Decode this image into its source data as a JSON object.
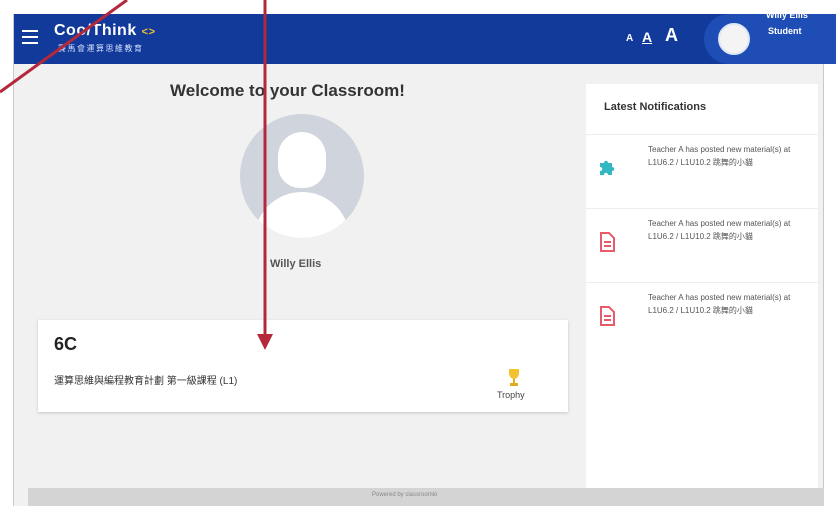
{
  "header": {
    "logo_main": "Coo/Think",
    "logo_accent": "<>",
    "logo_sub": "賽馬會運算思維教育",
    "font_small": "A",
    "font_medium": "A",
    "font_large": "A",
    "user_name": "Willy Ellis",
    "user_role": "Student"
  },
  "main": {
    "welcome_title": "Welcome to your Classroom!",
    "profile_name": "Willy Ellis",
    "class_card": {
      "code": "6C",
      "description": "運算思維與編程教育計劃 第一級課程 (L1)",
      "trophy_label": "Trophy"
    }
  },
  "notifications": {
    "title": "Latest Notifications",
    "items": [
      {
        "icon": "puzzle-icon",
        "text": "Teacher A has posted new material(s) at L1U6.2 / L1U10.2 跳舞的小貓"
      },
      {
        "icon": "document-icon",
        "text": "Teacher A has posted new material(s) at L1U6.2 / L1U10.2 跳舞的小貓"
      },
      {
        "icon": "document-icon",
        "text": "Teacher A has posted new material(s) at L1U6.2 / L1U10.2 跳舞的小貓"
      }
    ]
  },
  "footer": {
    "text": "Powered by classroomio"
  },
  "colors": {
    "header_bg": "#123a9a",
    "accent": "#f2c230",
    "arrow": "#b4283c",
    "puzzle": "#33b8c2",
    "document": "#e85b6b"
  }
}
